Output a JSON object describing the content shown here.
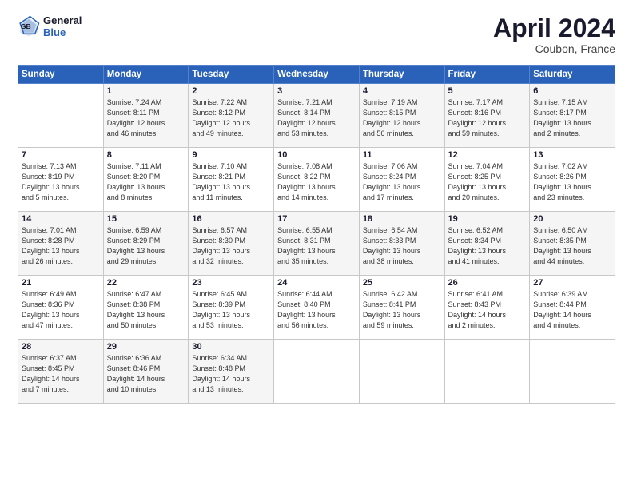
{
  "header": {
    "logo_line1": "General",
    "logo_line2": "Blue",
    "month": "April 2024",
    "location": "Coubon, France"
  },
  "weekdays": [
    "Sunday",
    "Monday",
    "Tuesday",
    "Wednesday",
    "Thursday",
    "Friday",
    "Saturday"
  ],
  "weeks": [
    [
      {
        "num": "",
        "info": ""
      },
      {
        "num": "1",
        "info": "Sunrise: 7:24 AM\nSunset: 8:11 PM\nDaylight: 12 hours\nand 46 minutes."
      },
      {
        "num": "2",
        "info": "Sunrise: 7:22 AM\nSunset: 8:12 PM\nDaylight: 12 hours\nand 49 minutes."
      },
      {
        "num": "3",
        "info": "Sunrise: 7:21 AM\nSunset: 8:14 PM\nDaylight: 12 hours\nand 53 minutes."
      },
      {
        "num": "4",
        "info": "Sunrise: 7:19 AM\nSunset: 8:15 PM\nDaylight: 12 hours\nand 56 minutes."
      },
      {
        "num": "5",
        "info": "Sunrise: 7:17 AM\nSunset: 8:16 PM\nDaylight: 12 hours\nand 59 minutes."
      },
      {
        "num": "6",
        "info": "Sunrise: 7:15 AM\nSunset: 8:17 PM\nDaylight: 13 hours\nand 2 minutes."
      }
    ],
    [
      {
        "num": "7",
        "info": "Sunrise: 7:13 AM\nSunset: 8:19 PM\nDaylight: 13 hours\nand 5 minutes."
      },
      {
        "num": "8",
        "info": "Sunrise: 7:11 AM\nSunset: 8:20 PM\nDaylight: 13 hours\nand 8 minutes."
      },
      {
        "num": "9",
        "info": "Sunrise: 7:10 AM\nSunset: 8:21 PM\nDaylight: 13 hours\nand 11 minutes."
      },
      {
        "num": "10",
        "info": "Sunrise: 7:08 AM\nSunset: 8:22 PM\nDaylight: 13 hours\nand 14 minutes."
      },
      {
        "num": "11",
        "info": "Sunrise: 7:06 AM\nSunset: 8:24 PM\nDaylight: 13 hours\nand 17 minutes."
      },
      {
        "num": "12",
        "info": "Sunrise: 7:04 AM\nSunset: 8:25 PM\nDaylight: 13 hours\nand 20 minutes."
      },
      {
        "num": "13",
        "info": "Sunrise: 7:02 AM\nSunset: 8:26 PM\nDaylight: 13 hours\nand 23 minutes."
      }
    ],
    [
      {
        "num": "14",
        "info": "Sunrise: 7:01 AM\nSunset: 8:28 PM\nDaylight: 13 hours\nand 26 minutes."
      },
      {
        "num": "15",
        "info": "Sunrise: 6:59 AM\nSunset: 8:29 PM\nDaylight: 13 hours\nand 29 minutes."
      },
      {
        "num": "16",
        "info": "Sunrise: 6:57 AM\nSunset: 8:30 PM\nDaylight: 13 hours\nand 32 minutes."
      },
      {
        "num": "17",
        "info": "Sunrise: 6:55 AM\nSunset: 8:31 PM\nDaylight: 13 hours\nand 35 minutes."
      },
      {
        "num": "18",
        "info": "Sunrise: 6:54 AM\nSunset: 8:33 PM\nDaylight: 13 hours\nand 38 minutes."
      },
      {
        "num": "19",
        "info": "Sunrise: 6:52 AM\nSunset: 8:34 PM\nDaylight: 13 hours\nand 41 minutes."
      },
      {
        "num": "20",
        "info": "Sunrise: 6:50 AM\nSunset: 8:35 PM\nDaylight: 13 hours\nand 44 minutes."
      }
    ],
    [
      {
        "num": "21",
        "info": "Sunrise: 6:49 AM\nSunset: 8:36 PM\nDaylight: 13 hours\nand 47 minutes."
      },
      {
        "num": "22",
        "info": "Sunrise: 6:47 AM\nSunset: 8:38 PM\nDaylight: 13 hours\nand 50 minutes."
      },
      {
        "num": "23",
        "info": "Sunrise: 6:45 AM\nSunset: 8:39 PM\nDaylight: 13 hours\nand 53 minutes."
      },
      {
        "num": "24",
        "info": "Sunrise: 6:44 AM\nSunset: 8:40 PM\nDaylight: 13 hours\nand 56 minutes."
      },
      {
        "num": "25",
        "info": "Sunrise: 6:42 AM\nSunset: 8:41 PM\nDaylight: 13 hours\nand 59 minutes."
      },
      {
        "num": "26",
        "info": "Sunrise: 6:41 AM\nSunset: 8:43 PM\nDaylight: 14 hours\nand 2 minutes."
      },
      {
        "num": "27",
        "info": "Sunrise: 6:39 AM\nSunset: 8:44 PM\nDaylight: 14 hours\nand 4 minutes."
      }
    ],
    [
      {
        "num": "28",
        "info": "Sunrise: 6:37 AM\nSunset: 8:45 PM\nDaylight: 14 hours\nand 7 minutes."
      },
      {
        "num": "29",
        "info": "Sunrise: 6:36 AM\nSunset: 8:46 PM\nDaylight: 14 hours\nand 10 minutes."
      },
      {
        "num": "30",
        "info": "Sunrise: 6:34 AM\nSunset: 8:48 PM\nDaylight: 14 hours\nand 13 minutes."
      },
      {
        "num": "",
        "info": ""
      },
      {
        "num": "",
        "info": ""
      },
      {
        "num": "",
        "info": ""
      },
      {
        "num": "",
        "info": ""
      }
    ]
  ]
}
